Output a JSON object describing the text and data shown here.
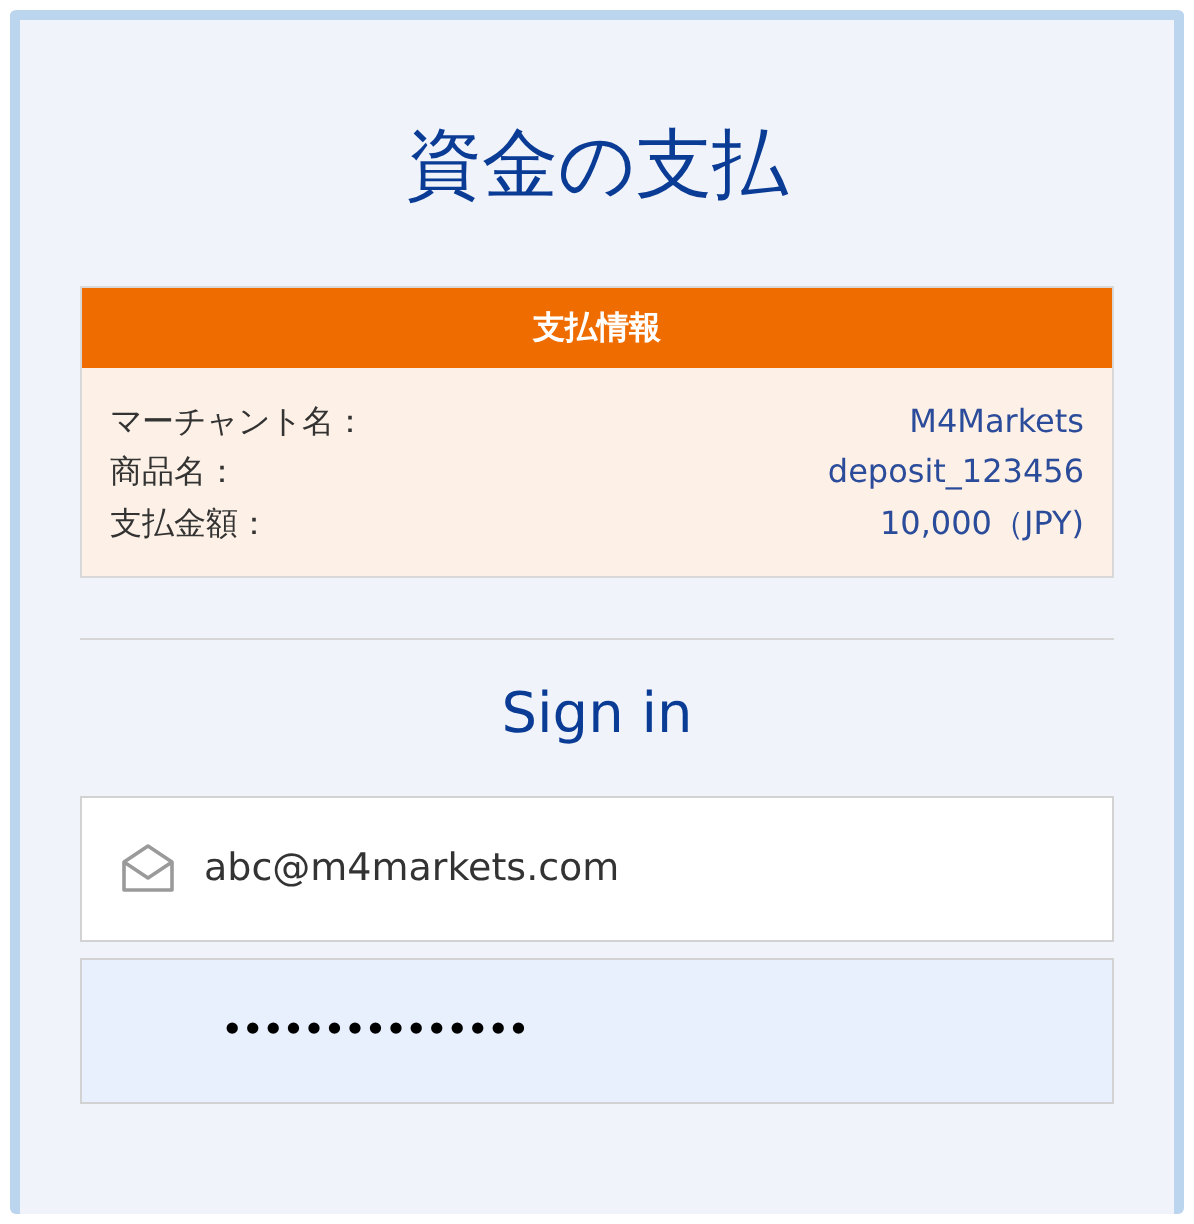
{
  "title": "資金の支払",
  "payment_info": {
    "header": "支払情報",
    "rows": [
      {
        "label": "マーチャント名：",
        "value": "M4Markets"
      },
      {
        "label": "商品名：",
        "value": "deposit_123456"
      },
      {
        "label": "支払金額：",
        "value": "10,000（JPY)"
      }
    ]
  },
  "sign_in": {
    "heading": "Sign in",
    "email": {
      "value": "abc@m4markets.com",
      "focused": false
    },
    "password": {
      "value": "•••••••••••••••",
      "focused": true
    }
  }
}
